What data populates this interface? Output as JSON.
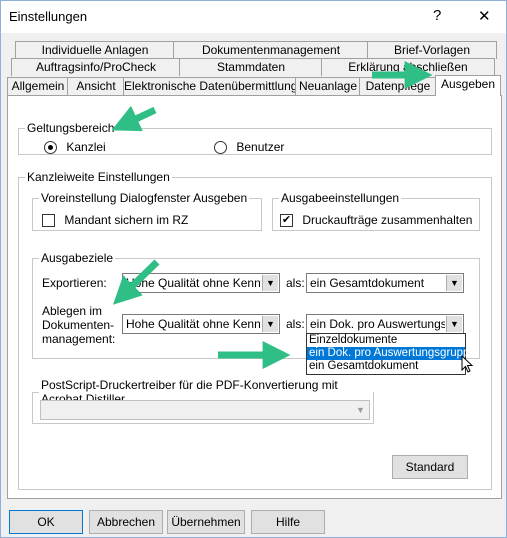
{
  "window": {
    "title": "Einstellungen",
    "help_glyph": "?",
    "close_glyph": "✕"
  },
  "tabs": {
    "row1": [
      "Individuelle Anlagen",
      "Dokumentenmanagement",
      "Brief-Vorlagen"
    ],
    "row2": [
      "Auftragsinfo/ProCheck",
      "Stammdaten",
      "Erklärung abschließen"
    ],
    "row3": [
      "Allgemein",
      "Ansicht",
      "Elektronische Datenübermittlung",
      "Neuanlage",
      "Datenpflege",
      "Ausgeben"
    ],
    "active": "Ausgeben"
  },
  "geltungsbereich": {
    "legend": "Geltungsbereich",
    "options": [
      {
        "label": "Kanzlei",
        "selected": true
      },
      {
        "label": "Benutzer",
        "selected": false
      }
    ]
  },
  "kanzleiweite": {
    "legend": "Kanzleiweite Einstellungen",
    "voreinstellung": {
      "legend": "Voreinstellung Dialogfenster Ausgeben",
      "checkbox_label": "Mandant sichern im RZ",
      "checked": false
    },
    "ausgabeeinstellungen": {
      "legend": "Ausgabeeinstellungen",
      "checkbox_label": "Druckaufträge zusammenhalten",
      "checked": true
    },
    "ausgabeziele": {
      "legend": "Ausgabeziele",
      "exportieren_label": "Exportieren:",
      "exportieren_value": "Hohe Qualität ohne Kennwort",
      "als_label": "als:",
      "exportieren_als": "ein Gesamtdokument",
      "ablegen_label_lines": [
        "Ablegen im",
        "Dokumenten-",
        "management:"
      ],
      "ablegen_value": "Hohe Qualität ohne Kennwort",
      "ablegen_als": "ein Dok. pro Auswertungsgruppe",
      "dropdown_options": [
        "Einzeldokumente",
        "ein Dok. pro Auswertungsgruppe",
        "ein Gesamtdokument"
      ],
      "dropdown_selected_index": 1
    },
    "postscript": {
      "legend": "PostScript-Druckertreiber für die PDF-Konvertierung mit Acrobat Distiller",
      "value": ""
    },
    "standard_button": "Standard"
  },
  "footer": {
    "ok": "OK",
    "abbrechen": "Abbrechen",
    "uebernehmen": "Übernehmen",
    "hilfe": "Hilfe"
  },
  "colors": {
    "annotation_arrow": "#2fbf86",
    "selection": "#0078d7"
  }
}
